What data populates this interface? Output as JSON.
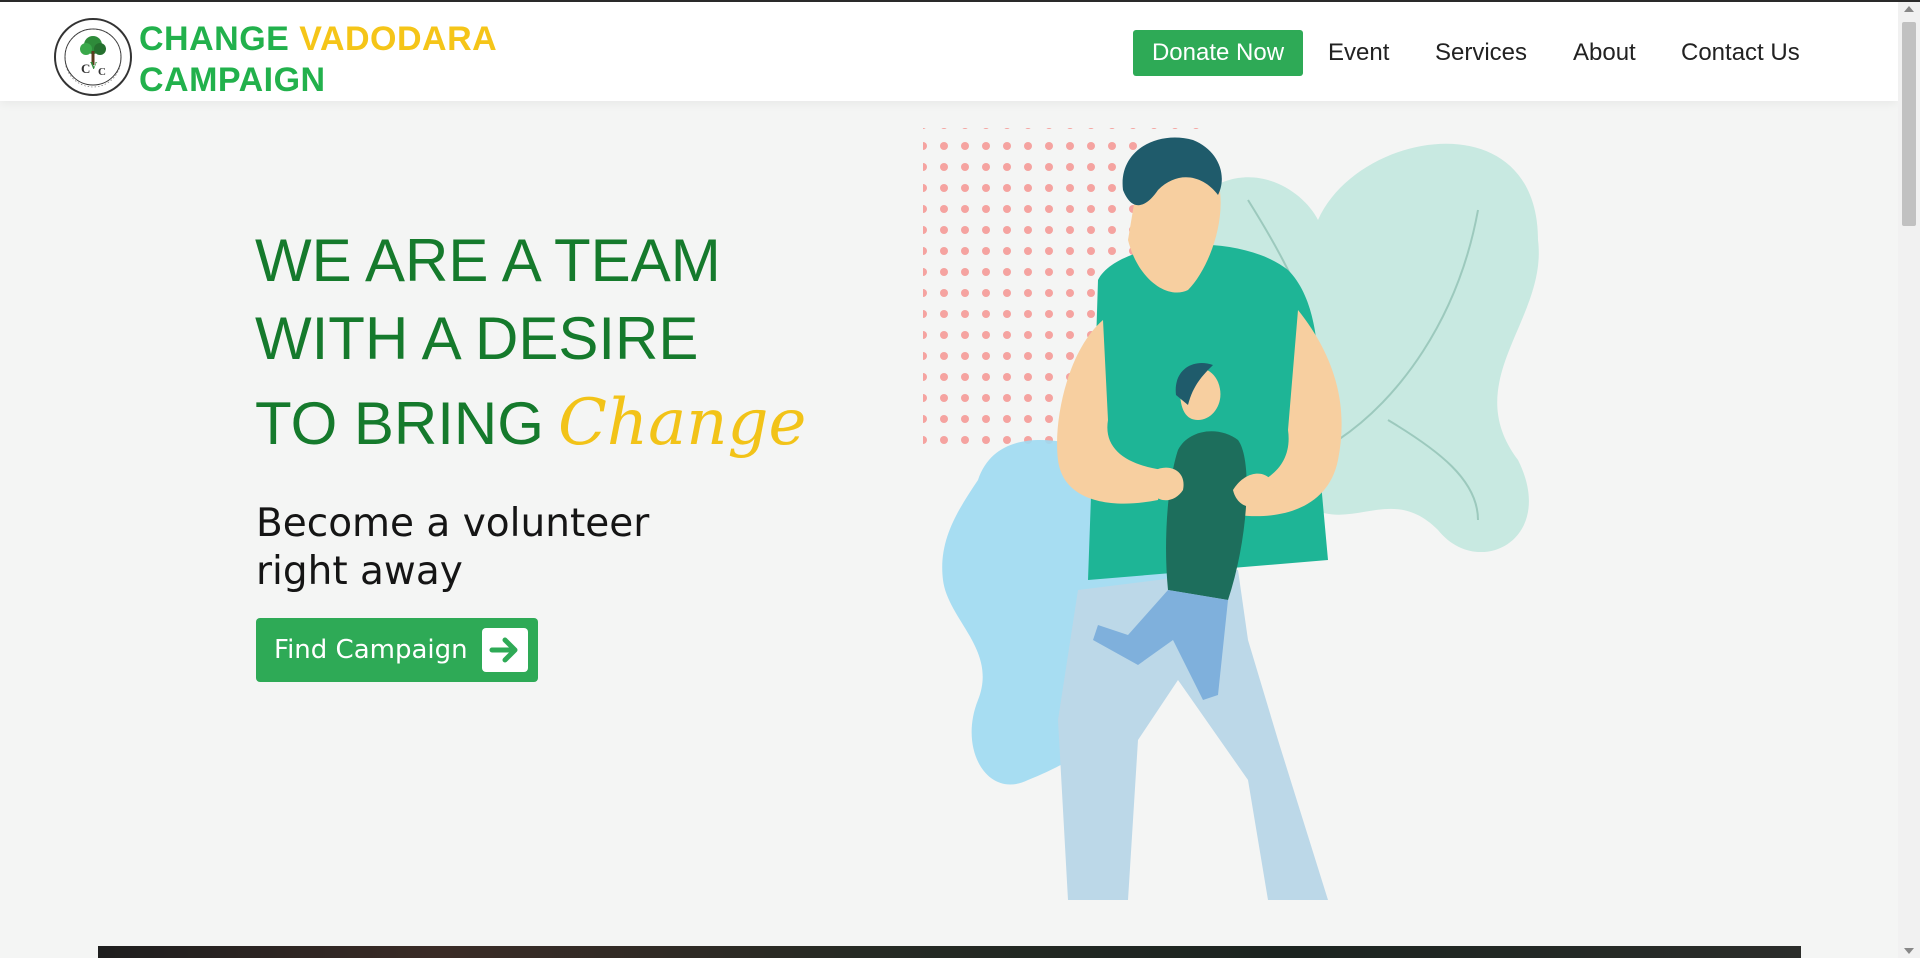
{
  "brand": {
    "word1": "CHANGE",
    "word2": "VADODARA",
    "word3": "CAMPAIGN",
    "emblem_text": "CHANGE VADODARA CAMPAIGN",
    "emblem_initials": "CVC"
  },
  "nav": {
    "donate_label": "Donate Now",
    "items": [
      {
        "label": "Event"
      },
      {
        "label": "Services"
      },
      {
        "label": "About"
      },
      {
        "label": "Contact Us"
      }
    ]
  },
  "hero": {
    "title_line1": "WE ARE A TEAM",
    "title_line2": "WITH A DESIRE",
    "title_line3": "TO BRING",
    "title_script": "Change",
    "subtitle_line1": "Become a volunteer",
    "subtitle_line2": "right away",
    "cta_label": "Find Campaign",
    "cta_icon": "arrow-right-icon"
  },
  "colors": {
    "brand_green": "#22b14c",
    "brand_yellow": "#f5c518",
    "button_green": "#2eaa56",
    "heading_green": "#157a2c"
  }
}
